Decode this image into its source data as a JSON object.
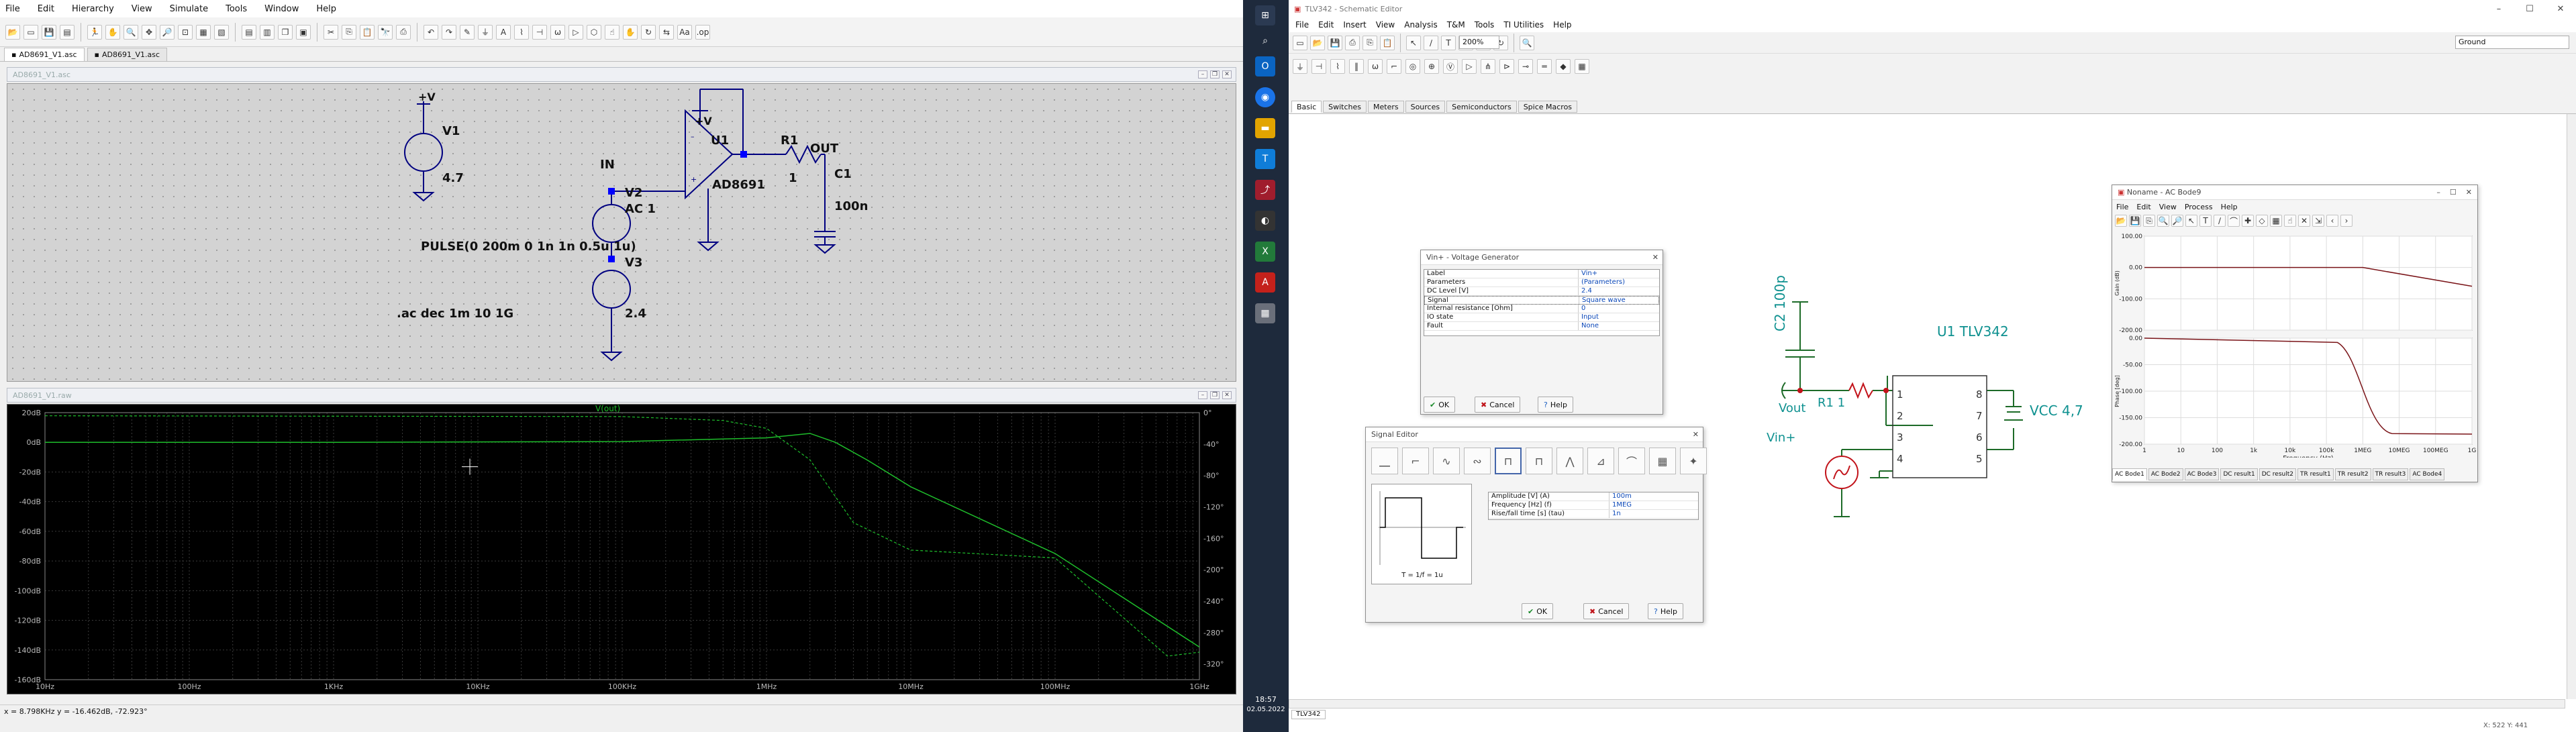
{
  "left": {
    "menu": [
      "File",
      "Edit",
      "Hierarchy",
      "View",
      "Simulate",
      "Tools",
      "Window",
      "Help"
    ],
    "tabs": [
      "AD8691_V1.asc",
      "AD8691_V1.asc"
    ],
    "schematic_window_title": "AD8691_V1.asc",
    "waveform_window_title": "AD8691_V1.raw",
    "labels": {
      "vplus1": "+V",
      "v1": "V1",
      "v1_val": "4.7",
      "in": "IN",
      "vplus2": "+V",
      "u1": "U1",
      "u1_part": "AD8691",
      "r1": "R1",
      "r1_val": "1",
      "out": "OUT",
      "c1": "C1",
      "c1_val": "100n",
      "v2": "V2",
      "v2_ac": "AC 1",
      "pulse": "PULSE(0 200m 0 1n 1n 0.5u 1u)",
      "v3": "V3",
      "v3_val": "2.4",
      "ac_cmd": ".ac dec 1m 10 1G"
    },
    "trace_name": "V(out)",
    "status": "x = 8.798KHz   y = -16.462dB, -72.923°"
  },
  "chart_data": {
    "type": "line",
    "title": "",
    "xscale": "log",
    "x_ticks": [
      "10Hz",
      "100Hz",
      "1KHz",
      "10KHz",
      "100KHz",
      "1MHz",
      "10MHz",
      "100MHz",
      "1GHz"
    ],
    "y_left_ticks": [
      "20dB",
      "0dB",
      "-20dB",
      "-40dB",
      "-60dB",
      "-80dB",
      "-100dB",
      "-120dB",
      "-140dB",
      "-160dB"
    ],
    "y_right_ticks": [
      "0°",
      "-40°",
      "-80°",
      "-120°",
      "-160°",
      "-200°",
      "-240°",
      "-280°",
      "-320°"
    ],
    "xlim": [
      10,
      1000000000
    ],
    "ylim_db": [
      -160,
      20
    ],
    "ylim_phase": [
      -340,
      0
    ],
    "grid": true,
    "series": [
      {
        "name": "V(out)",
        "unit": "dB",
        "x": [
          10,
          1000,
          100000,
          1000000,
          2000000,
          3000000,
          5000000,
          10000000,
          100000000,
          1000000000
        ],
        "y": [
          0,
          0,
          0.5,
          3,
          6,
          0,
          -12,
          -30,
          -75,
          -138
        ]
      },
      {
        "name": "V(out)",
        "unit": "deg",
        "x": [
          10,
          100000,
          500000,
          1000000,
          2000000,
          4000000,
          10000000,
          100000000,
          600000000,
          1000000000
        ],
        "y": [
          -4,
          -5,
          -10,
          -20,
          -60,
          -140,
          -175,
          -185,
          -310,
          -305
        ]
      }
    ],
    "color": "#1ebd2b"
  },
  "right": {
    "window_title": "TLV342 - Schematic Editor",
    "window_controls": [
      "–",
      "☐",
      "✕"
    ],
    "menu": [
      "File",
      "Edit",
      "Insert",
      "View",
      "Analysis",
      "T&M",
      "Tools",
      "TI Utilities",
      "Help"
    ],
    "zoom": "200%",
    "ground_select": "Ground",
    "component_tabs": [
      "Basic",
      "Switches",
      "Meters",
      "Sources",
      "Semiconductors",
      "Spice Macros"
    ],
    "circuit": {
      "c2": "C2 100p",
      "vout": "Vout",
      "r1": "R1 1",
      "u1": "U1 TLV342",
      "vcc": "VCC 4,7",
      "vin": "Vin+",
      "pins_left": [
        "1",
        "2",
        "3",
        "4"
      ],
      "pins_right": [
        "8",
        "7",
        "6",
        "5"
      ]
    },
    "vgen_dialog": {
      "title": "Vin+ - Voltage Generator",
      "rows": [
        {
          "label": "Label",
          "value": "Vin+"
        },
        {
          "label": "Parameters",
          "value": "(Parameters)"
        },
        {
          "label": "DC Level [V]",
          "value": "2.4"
        },
        {
          "label": "Signal",
          "value": "Square wave"
        },
        {
          "label": "Internal resistance [Ohm]",
          "value": "0"
        },
        {
          "label": "IO state",
          "value": "Input"
        },
        {
          "label": "Fault",
          "value": "None"
        }
      ],
      "ok": "OK",
      "cancel": "Cancel",
      "help": "Help"
    },
    "signal_editor": {
      "title": "Signal Editor",
      "caption": "T = 1/f = 1u",
      "rows": [
        {
          "label": "Amplitude [V] (A)",
          "value": "100m"
        },
        {
          "label": "Frequency [Hz] (f)",
          "value": "1MEG"
        },
        {
          "label": "Rise/fall time [s] (tau)",
          "value": "1n"
        }
      ],
      "ok": "OK",
      "cancel": "Cancel",
      "help": "Help"
    },
    "bode": {
      "title": "Noname - AC Bode9",
      "window_controls": [
        "–",
        "☐",
        "✕"
      ],
      "menu": [
        "File",
        "Edit",
        "View",
        "Process",
        "Help"
      ],
      "gain_axis": "Gain (dB)",
      "phase_axis": "Phase [deg]",
      "x_axis": "Frequency (Hz)",
      "gain_ticks": [
        "100.00",
        "0.00",
        "-100.00",
        "-200.00"
      ],
      "phase_ticks": [
        "0.00",
        "-50.00",
        "-100.00",
        "-150.00",
        "-200.00"
      ],
      "x_ticks": [
        "1",
        "10",
        "100",
        "1k",
        "10k",
        "100k",
        "1MEG",
        "10MEG",
        "100MEG",
        "1G"
      ],
      "tabs": [
        "AC Bode1",
        "AC Bode2",
        "AC Bode3",
        "DC result1",
        "DC result2",
        "TR result1",
        "TR result2",
        "TR result3",
        "AC Bode4"
      ]
    },
    "status_tab": "TLV342",
    "status_text": "X: 522  Y: 441"
  },
  "taskbar": {
    "clock": "18:57",
    "date": "02.05.2022"
  }
}
